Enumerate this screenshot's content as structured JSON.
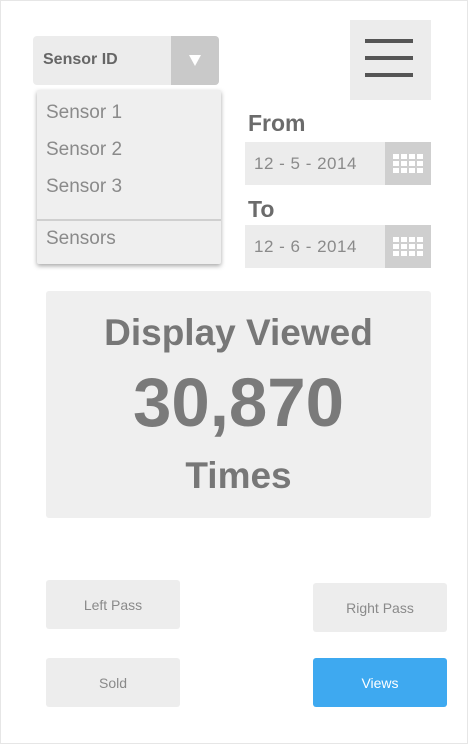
{
  "sensor_select": {
    "label": "Sensor ID",
    "options": [
      "Sensor 1",
      "Sensor 2",
      "Sensor 3"
    ],
    "footer_option": "Sensors"
  },
  "menu": {
    "icon": "hamburger-menu-icon"
  },
  "date_range": {
    "from_label": "From",
    "from_value": "12 - 5 - 2014",
    "to_label": "To",
    "to_value": "12 - 6 - 2014",
    "calendar_icon": "calendar-icon"
  },
  "stats": {
    "title": "Display Viewed",
    "value": "30,870",
    "unit": "Times"
  },
  "buttons": {
    "left_pass": "Left Pass",
    "right_pass": "Right Pass",
    "sold": "Sold",
    "views": "Views"
  },
  "colors": {
    "accent": "#3ea9f0",
    "panel_bg": "#efefef",
    "text_gray": "#777777"
  }
}
